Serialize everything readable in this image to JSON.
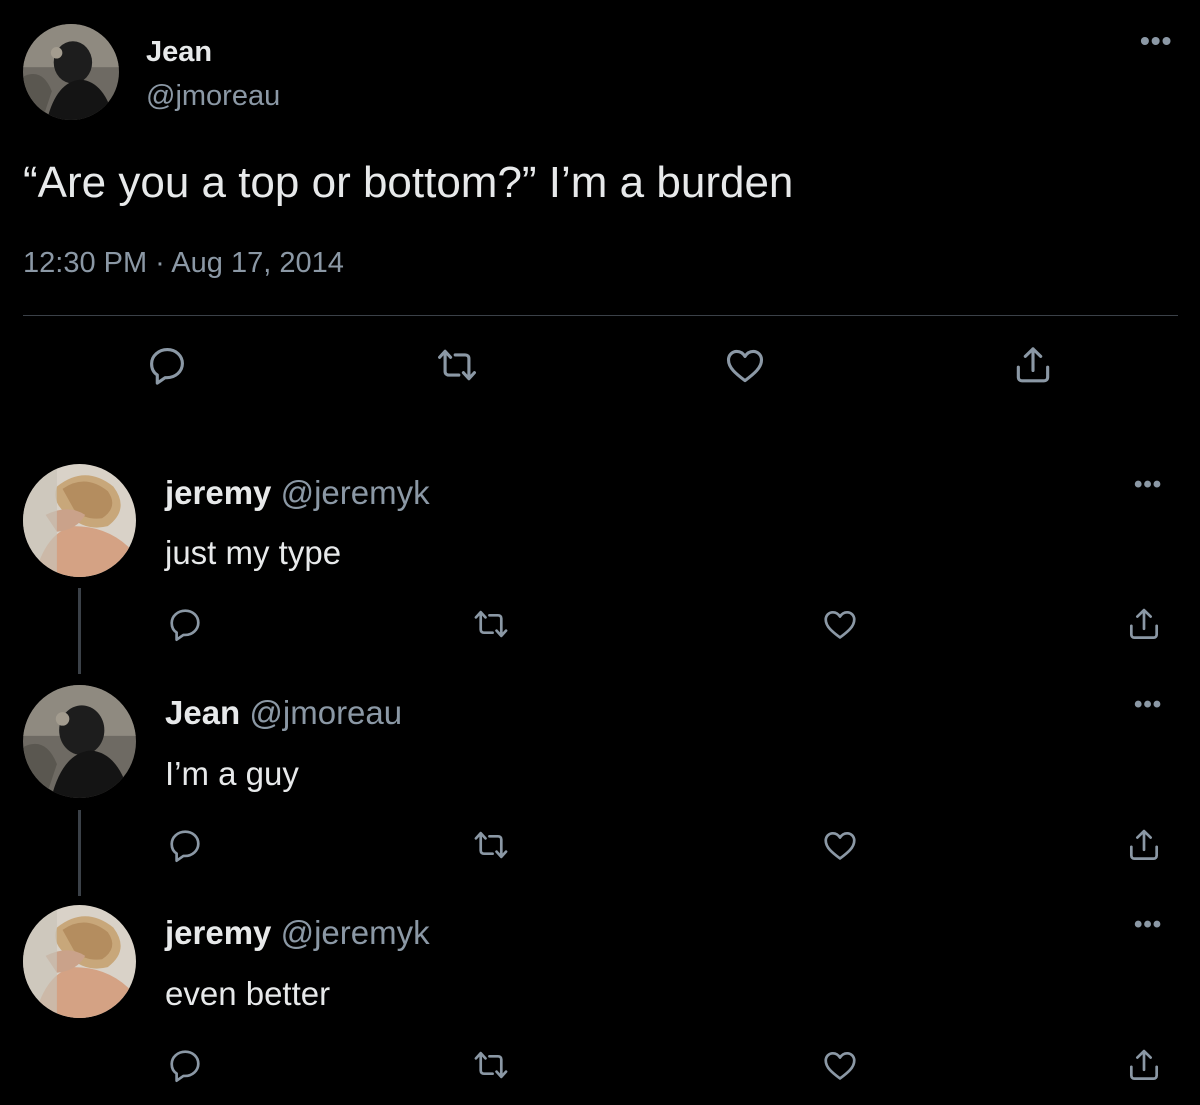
{
  "main_tweet": {
    "author_name": "Jean",
    "author_handle": "@jmoreau",
    "text": "“Are you a top or bottom?” I’m a burden",
    "timestamp": "12:30 PM · Aug 17, 2014",
    "more_icon": "more-dots-icon",
    "actions": [
      "reply-icon",
      "retweet-icon",
      "like-icon",
      "share-icon"
    ]
  },
  "replies": [
    {
      "author_name": "jeremy",
      "author_handle": "@jeremyk",
      "text": "just my type"
    },
    {
      "author_name": "Jean",
      "author_handle": "@jmoreau",
      "text": "I’m a guy"
    },
    {
      "author_name": "jeremy",
      "author_handle": "@jeremyk",
      "text": "even better"
    }
  ],
  "colors": {
    "background": "#000000",
    "text": "#e7e9ea",
    "secondary": "#8b98a5",
    "divider": "#3b4148"
  }
}
